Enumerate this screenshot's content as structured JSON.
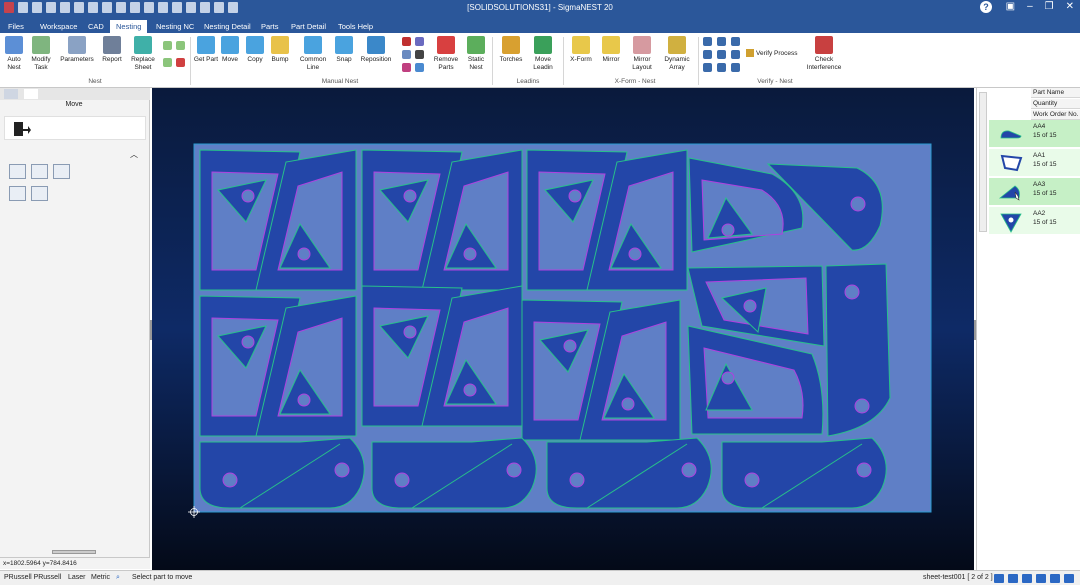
{
  "window": {
    "title": "[SOLIDSOLUTIONS31] - SigmaNEST 20",
    "help_glyph": "?"
  },
  "menu": {
    "tabs": [
      "Files",
      "Workspace",
      "CAD",
      "Nesting",
      "Nesting NC",
      "Nesting Detail",
      "Parts",
      "Part Detail",
      "Tools Help"
    ],
    "active": "Nesting"
  },
  "ribbon": {
    "nest_group": "Nest",
    "manual_nest_group": "Manual Nest",
    "leadins_group": "Leadins",
    "xform_group": "X-Form - Nest",
    "verify_group": "Verify - Nest",
    "auto_nest": "Auto Nest",
    "modify_task": "Modify Task",
    "parameters": "Parameters",
    "report": "Report",
    "replace_sheet": "Replace Sheet",
    "get_part": "Get Part",
    "move": "Move",
    "copy": "Copy",
    "bump": "Bump",
    "common_line": "Common Line",
    "snap": "Snap",
    "reposition": "Reposition",
    "remove_parts": "Remove Parts",
    "static_nest": "Static Nest",
    "torches": "Torches",
    "move_leadin": "Move Leadin",
    "xform": "X-Form",
    "mirror": "Mirror",
    "mirror_layout": "Mirror Layout",
    "dynamic_array": "Dynamic Array",
    "verify_process": "Verify Process",
    "check_interference": "Check Interference"
  },
  "left_panel": {
    "title": "Move",
    "coords": "x=1802.5964 y=784.8416"
  },
  "parts_list": {
    "headers": [
      "Part Name",
      "Quantity",
      "Work Order No."
    ],
    "items": [
      {
        "name": "AA4",
        "qty": "15 of 15"
      },
      {
        "name": "AA1",
        "qty": "15 of 15"
      },
      {
        "name": "AA3",
        "qty": "15 of 15"
      },
      {
        "name": "AA2",
        "qty": "15 of 15"
      }
    ]
  },
  "status": {
    "user": "PRussell PRussell",
    "process": "Laser",
    "units": "Metric",
    "message": "Select part to move",
    "sheet": "sheet-test001 [ 2 of 2 ]"
  },
  "colors": {
    "accent": "#2b579a",
    "sheet": "#5f7fc6",
    "part_fill": "#2346a8",
    "part_edge": "#27c08a",
    "inner_edge": "#b040e0",
    "canvas_bg": "#0b1d42"
  }
}
